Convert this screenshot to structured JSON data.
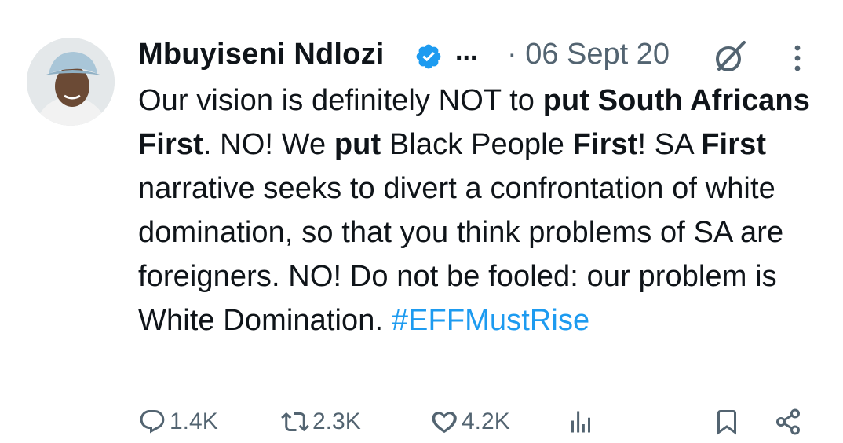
{
  "tweet": {
    "author_name": "Mbuyiseni Ndlozi",
    "truncation": "...",
    "date": "· 06 Sept 20",
    "body": [
      {
        "text": "Our vision is definitely NOT to ",
        "bold": false
      },
      {
        "text": "put South Africans First",
        "bold": true
      },
      {
        "text": ". NO! We ",
        "bold": false
      },
      {
        "text": "put",
        "bold": true
      },
      {
        "text": " Black People ",
        "bold": false
      },
      {
        "text": "First",
        "bold": true
      },
      {
        "text": "! SA ",
        "bold": false
      },
      {
        "text": "First",
        "bold": true
      },
      {
        "text": " narrative seeks to divert a confrontation of white domination, so that you think problems of SA are foreigners. NO! Do not be fooled: our problem is White Domination. ",
        "bold": false
      }
    ],
    "hashtag": "#EFFMustRise"
  },
  "actions": {
    "replies": "1.4K",
    "reposts": "2.3K",
    "likes": "4.2K"
  },
  "icons": [
    "verified-badge-icon",
    "grok-icon",
    "more-options-icon",
    "reply-icon",
    "repost-icon",
    "like-icon",
    "views-icon",
    "bookmark-icon",
    "share-icon"
  ],
  "colors": {
    "verified": "#1d9bf0",
    "hashtag": "#1d9bf0",
    "secondary": "#536471",
    "text": "#0f1419"
  }
}
